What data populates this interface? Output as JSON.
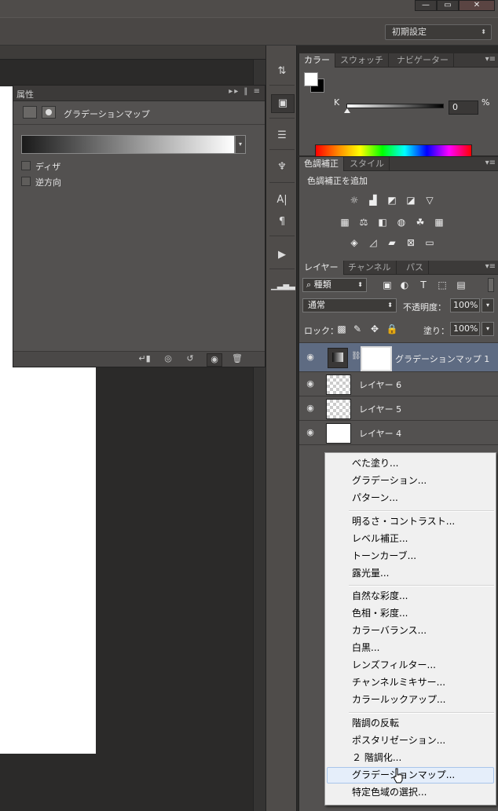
{
  "window": {
    "minimize": "—",
    "restore": "▭",
    "close": "✕"
  },
  "workspace": {
    "value": "初期設定",
    "arrow": "⬍"
  },
  "dock": {
    "items": [
      "history-icon",
      "properties-icon",
      "adjust-icon",
      "brush-icon",
      "character-icon",
      "paragraph-icon",
      "play-icon",
      "histogram-icon"
    ]
  },
  "properties": {
    "title": "属性",
    "subtitle": "グラデーションマップ",
    "dither_label": "ディザ",
    "reverse_label": "逆方向"
  },
  "color_panel": {
    "tabs": [
      "カラー",
      "スウォッチ",
      "ナビゲーター"
    ],
    "k_label": "K",
    "k_value": "0",
    "pct": "%"
  },
  "adjustments": {
    "tabs": [
      "色調補正",
      "スタイル"
    ],
    "heading": "色調補正を追加"
  },
  "layers": {
    "tabs": [
      "レイヤー",
      "チャンネル",
      "パス"
    ],
    "filter_kind": "種類",
    "blend_mode": "通常",
    "opacity_label": "不透明度：",
    "opacity_value": "100%",
    "lock_label": "ロック：",
    "fill_label": "塗り：",
    "fill_value": "100%",
    "items": [
      {
        "name": "グラデーションマップ 1",
        "selected": true
      },
      {
        "name": "レイヤー 6"
      },
      {
        "name": "レイヤー 5"
      },
      {
        "name": "レイヤー 4"
      }
    ]
  },
  "menu": {
    "group1": [
      "べた塗り...",
      "グラデーション...",
      "パターン..."
    ],
    "group2": [
      "明るさ・コントラスト...",
      "レベル補正...",
      "トーンカーブ...",
      "露光量..."
    ],
    "group3": [
      "自然な彩度...",
      "色相・彩度...",
      "カラーバランス...",
      "白黒...",
      "レンズフィルター...",
      "チャンネルミキサー...",
      "カラールックアップ..."
    ],
    "group4": [
      "階調の反転",
      "ポスタリゼーション...",
      "２ 階調化...",
      "グラデーションマップ...",
      "特定色域の選択..."
    ],
    "hovered": "グラデーションマップ..."
  },
  "colors": {
    "selection": "#5e6b82",
    "menu_hover": "#e5eefa",
    "panel": "#535150"
  }
}
